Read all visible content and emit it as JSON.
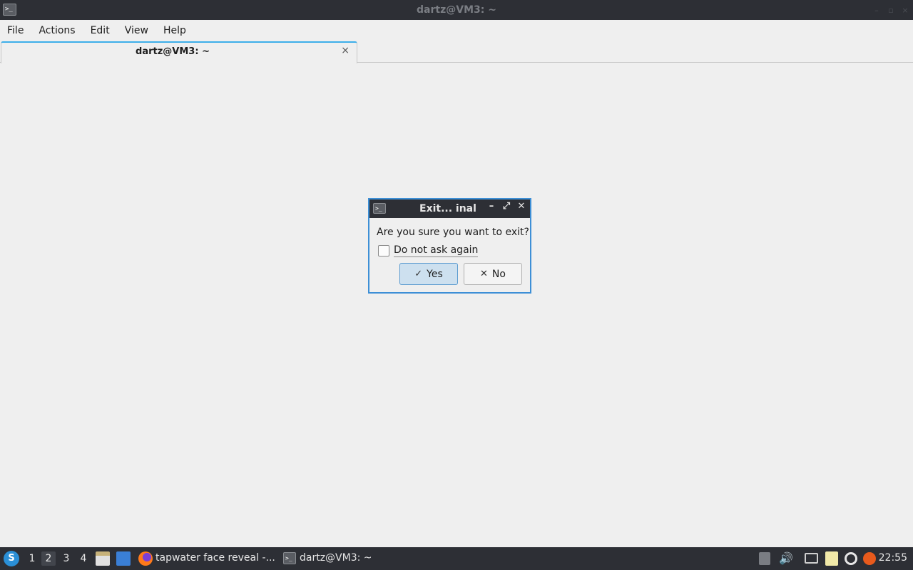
{
  "window": {
    "title": "dartz@VM3: ~",
    "controls": [
      "–",
      "▫",
      "×"
    ]
  },
  "menu": {
    "items": [
      "File",
      "Actions",
      "Edit",
      "View",
      "Help"
    ]
  },
  "tabs": [
    {
      "label": "dartz@VM3: ~",
      "close": "×"
    }
  ],
  "dialog": {
    "title": "Exit... inal",
    "question": "Are you sure you want to exit?",
    "checkbox_label": "Do not ask again",
    "checkbox_checked": false,
    "yes_label": "Yes",
    "no_label": "No",
    "yes_icon": "✓",
    "no_icon": "✕",
    "controls": [
      "–",
      "⤢",
      "✕"
    ]
  },
  "taskbar": {
    "workspaces": [
      "1",
      "2",
      "3",
      "4"
    ],
    "active_workspace": "2",
    "tasks": [
      {
        "label": "tapwater face reveal -...",
        "icon": "firefox-icon"
      },
      {
        "label": "dartz@VM3: ~",
        "icon": "terminal-icon"
      }
    ],
    "clock": "22:55"
  },
  "colors": {
    "titlebar": "#2d2f35",
    "accent": "#3d8fd6",
    "background": "#efefef"
  }
}
